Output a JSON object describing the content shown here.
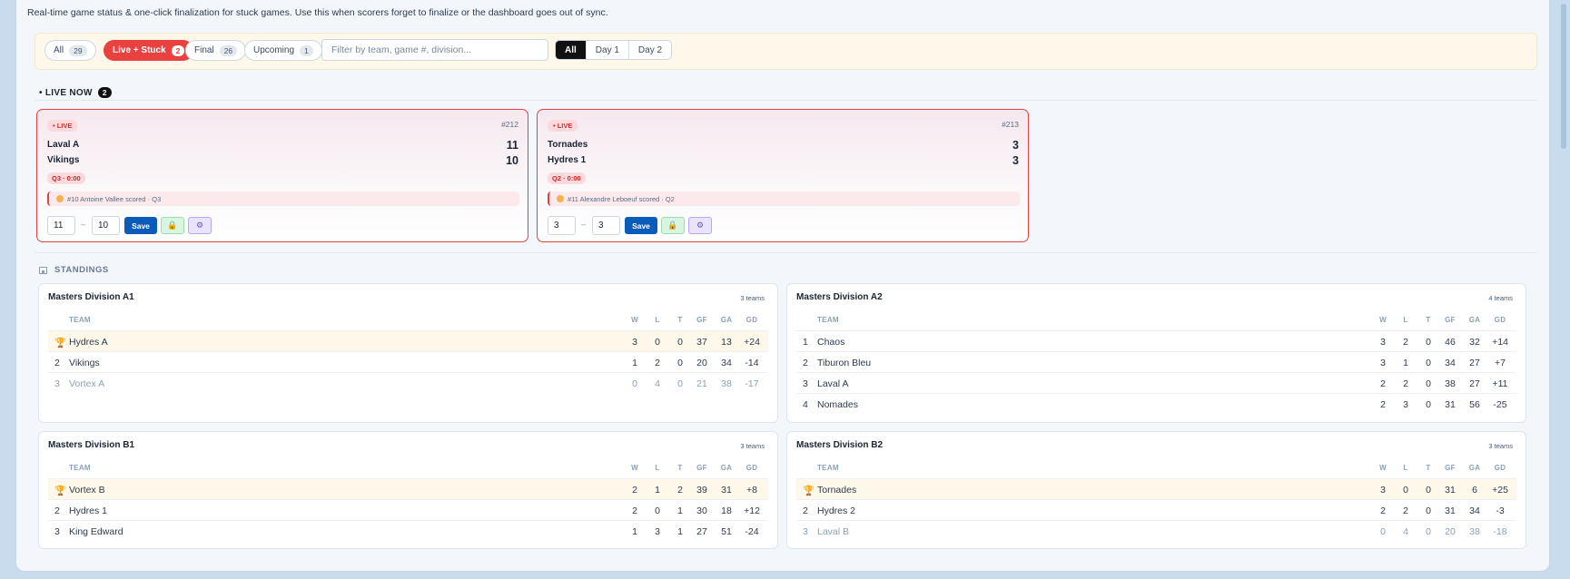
{
  "subtitle": "Real-time game status & one-click finalization for stuck games. Use this when scorers forget to finalize or the dashboard goes out of sync.",
  "filters": {
    "chips": [
      {
        "label": "All",
        "count": "29"
      },
      {
        "label": "Live + Stuck",
        "count": "2"
      },
      {
        "label": "Final",
        "count": "26"
      },
      {
        "label": "Upcoming",
        "count": "1"
      }
    ],
    "search_placeholder": "Filter by team, game #, division...",
    "days": [
      "All",
      "Day 1",
      "Day 2"
    ]
  },
  "live": {
    "heading": "• LIVE NOW",
    "count": "2",
    "games": [
      {
        "badge": "• LIVE",
        "number": "#212",
        "home": "Laval A",
        "home_score": "11",
        "away": "Vikings",
        "away_score": "10",
        "period": "Q3 · 0:00",
        "event": "#10 Antoine Vallee scored · Q3",
        "input_home": "11",
        "input_away": "10",
        "dash": "–",
        "save": "Save",
        "lock_icon": "🔒",
        "gear_icon": "⚙"
      },
      {
        "badge": "• LIVE",
        "number": "#213",
        "home": "Tornades",
        "home_score": "3",
        "away": "Hydres 1",
        "away_score": "3",
        "period": "Q2 · 0:00",
        "event": "#11 Alexandre Leboeuf scored · Q2",
        "input_home": "3",
        "input_away": "3",
        "dash": "–",
        "save": "Save",
        "lock_icon": "🔒",
        "gear_icon": "⚙"
      }
    ]
  },
  "standings": {
    "heading": "STANDINGS",
    "columns": [
      "TEAM",
      "W",
      "L",
      "T",
      "GF",
      "GA",
      "GD"
    ],
    "trophy": "🏆",
    "divisions": [
      {
        "name": "Masters Division A1",
        "count": "3 teams",
        "rows": [
          {
            "rank": "1",
            "team": "Hydres A",
            "w": "3",
            "l": "0",
            "t": "0",
            "gf": "37",
            "ga": "13",
            "gd": "+24"
          },
          {
            "rank": "2",
            "team": "Vikings",
            "w": "1",
            "l": "2",
            "t": "0",
            "gf": "20",
            "ga": "34",
            "gd": "-14"
          },
          {
            "rank": "3",
            "team": "Vortex A",
            "w": "0",
            "l": "4",
            "t": "0",
            "gf": "21",
            "ga": "38",
            "gd": "-17"
          }
        ]
      },
      {
        "name": "Masters Division A2",
        "count": "4 teams",
        "rows": [
          {
            "rank": "1",
            "team": "Chaos",
            "w": "3",
            "l": "2",
            "t": "0",
            "gf": "46",
            "ga": "32",
            "gd": "+14"
          },
          {
            "rank": "2",
            "team": "Tiburon Bleu",
            "w": "3",
            "l": "1",
            "t": "0",
            "gf": "34",
            "ga": "27",
            "gd": "+7"
          },
          {
            "rank": "3",
            "team": "Laval A",
            "w": "2",
            "l": "2",
            "t": "0",
            "gf": "38",
            "ga": "27",
            "gd": "+11"
          },
          {
            "rank": "4",
            "team": "Nomades",
            "w": "2",
            "l": "3",
            "t": "0",
            "gf": "31",
            "ga": "56",
            "gd": "-25"
          }
        ]
      },
      {
        "name": "Masters Division B1",
        "count": "3 teams",
        "rows": [
          {
            "rank": "1",
            "team": "Vortex B",
            "w": "2",
            "l": "1",
            "t": "2",
            "gf": "39",
            "ga": "31",
            "gd": "+8"
          },
          {
            "rank": "2",
            "team": "Hydres 1",
            "w": "2",
            "l": "0",
            "t": "1",
            "gf": "30",
            "ga": "18",
            "gd": "+12"
          },
          {
            "rank": "3",
            "team": "King Edward",
            "w": "1",
            "l": "3",
            "t": "1",
            "gf": "27",
            "ga": "51",
            "gd": "-24"
          }
        ]
      },
      {
        "name": "Masters Division B2",
        "count": "3 teams",
        "rows": [
          {
            "rank": "1",
            "team": "Tornades",
            "w": "3",
            "l": "0",
            "t": "0",
            "gf": "31",
            "ga": "6",
            "gd": "+25"
          },
          {
            "rank": "2",
            "team": "Hydres 2",
            "w": "2",
            "l": "2",
            "t": "0",
            "gf": "31",
            "ga": "34",
            "gd": "-3"
          },
          {
            "rank": "3",
            "team": "Laval B",
            "w": "0",
            "l": "4",
            "t": "0",
            "gf": "20",
            "ga": "38",
            "gd": "-18"
          }
        ]
      }
    ]
  }
}
